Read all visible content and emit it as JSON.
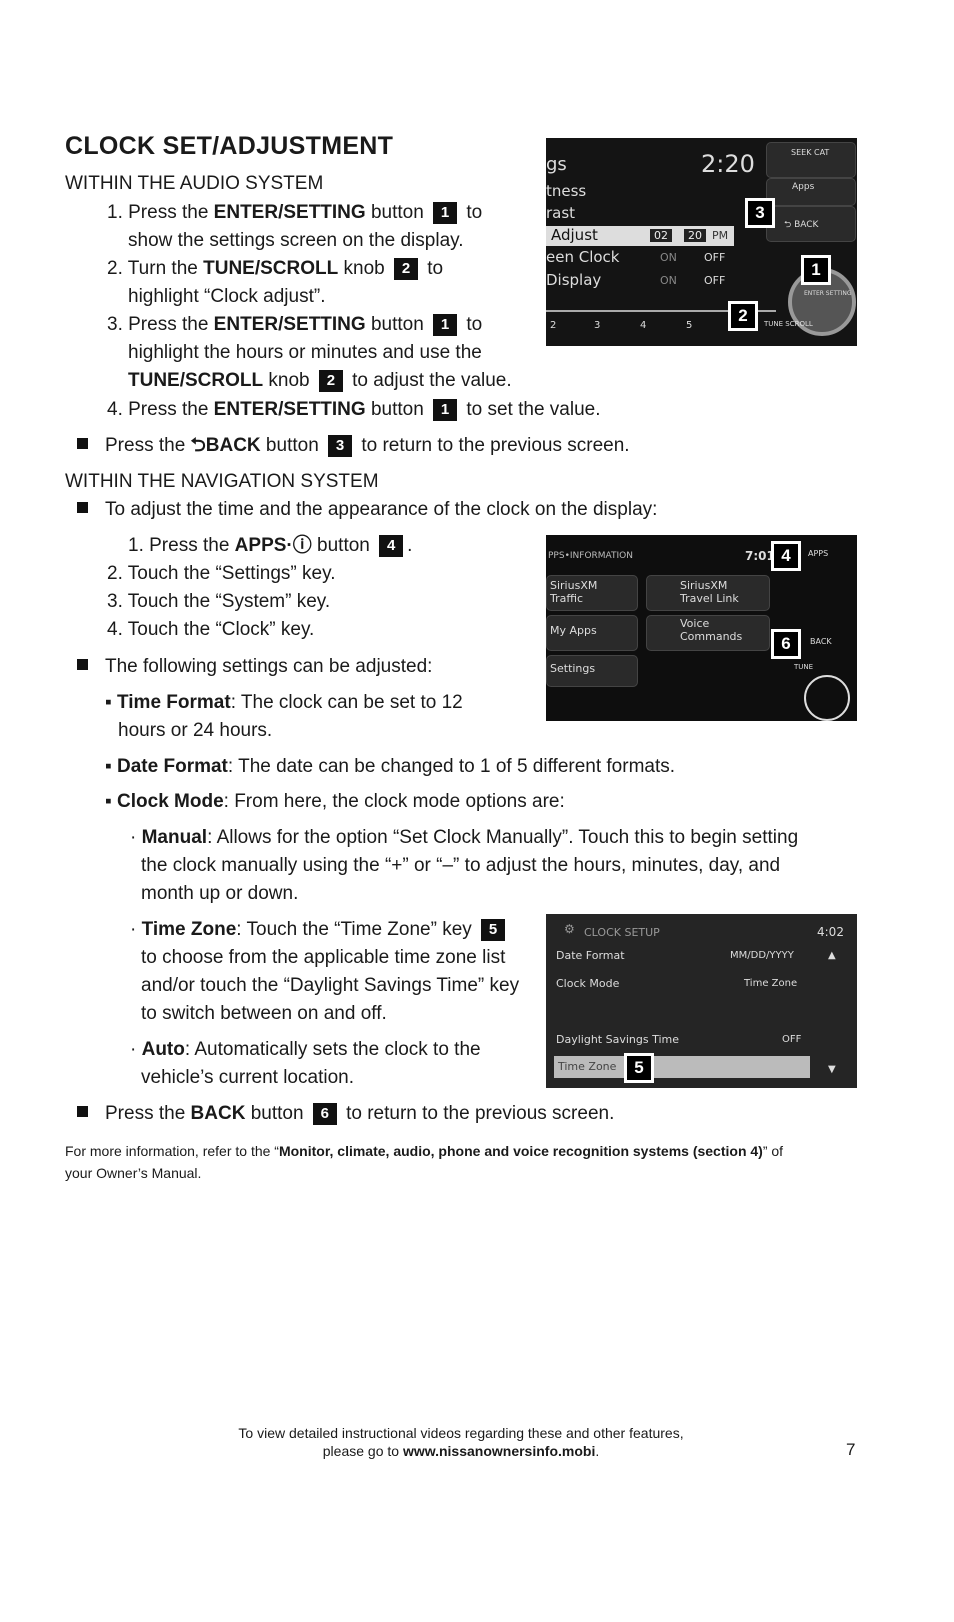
{
  "heading": "CLOCK SET/ADJUSTMENT",
  "lines": [
    [
      {
        "t": "WITHIN THE AUDIO SYSTEM"
      }
    ],
    [
      {
        "t": "1. Press the "
      },
      {
        "b": "ENTER/SETTING"
      },
      {
        "t": " button "
      },
      {
        "badge": "1"
      },
      {
        "t": " to"
      }
    ],
    [
      {
        "t": "show the settings screen on the display."
      }
    ],
    [
      {
        "t": "2. Turn the "
      },
      {
        "b": "TUNE/SCROLL"
      },
      {
        "t": " knob "
      },
      {
        "badge": "2"
      },
      {
        "t": " to"
      }
    ],
    [
      {
        "t": "highlight “Clock adjust”."
      }
    ],
    [
      {
        "t": "3. Press the "
      },
      {
        "b": "ENTER/SETTING"
      },
      {
        "t": " button "
      },
      {
        "badge": "1"
      },
      {
        "t": " to"
      }
    ],
    [
      {
        "t": "highlight the hours or minutes and use the"
      }
    ],
    [
      {
        "b": "TUNE/SCROLL"
      },
      {
        "t": " knob "
      },
      {
        "badge": "2"
      },
      {
        "t": " to adjust the value."
      }
    ],
    [
      {
        "t": "4. Press the "
      },
      {
        "b": "ENTER/SETTING"
      },
      {
        "t": " button "
      },
      {
        "badge": "1"
      },
      {
        "t": " to set the value."
      }
    ],
    [
      {
        "sq": true
      },
      {
        "t": "Press the "
      },
      {
        "b": "⮌BACK"
      },
      {
        "t": " button "
      },
      {
        "badge": "3"
      },
      {
        "t": " to return to the previous screen."
      }
    ],
    [
      {
        "t": "WITHIN THE NAVIGATION SYSTEM"
      }
    ],
    [
      {
        "sq": true
      },
      {
        "t": "To adjust the time and the appearance of the clock on the display:"
      }
    ],
    [
      {
        "t": "1. Press the "
      },
      {
        "b": "APPS·ⓘ"
      },
      {
        "t": " button "
      },
      {
        "badge": "4"
      },
      {
        "t": "."
      }
    ],
    [
      {
        "t": "2. Touch the “Settings” key."
      }
    ],
    [
      {
        "t": "3. Touch the “System” key."
      }
    ],
    [
      {
        "t": "4. Touch the “Clock” key."
      }
    ],
    [
      {
        "sq": true
      },
      {
        "t": "The following settings can be adjusted:"
      }
    ],
    [
      {
        "t": "▪ "
      },
      {
        "b": "Time Format"
      },
      {
        "t": ": The clock can be set to 12"
      }
    ],
    [
      {
        "t": "hours or 24 hours."
      }
    ],
    [
      {
        "t": "▪ "
      },
      {
        "b": "Date Format"
      },
      {
        "t": ": The date can be changed to 1 of 5 different formats."
      }
    ],
    [
      {
        "t": "▪ "
      },
      {
        "b": "Clock Mode"
      },
      {
        "t": ": From here, the clock mode options are:"
      }
    ],
    [
      {
        "t": "· "
      },
      {
        "b": "Manual"
      },
      {
        "t": ": Allows for the option “Set Clock Manually”. Touch this to begin setting"
      }
    ],
    [
      {
        "t": "the clock manually using the “+” or “–” to adjust the hours, minutes, day, and"
      }
    ],
    [
      {
        "t": "month up or down."
      }
    ],
    [
      {
        "t": "· "
      },
      {
        "b": "Time Zone"
      },
      {
        "t": ": Touch the “Time Zone” key "
      },
      {
        "badge": "5"
      }
    ],
    [
      {
        "t": "to choose from the applicable time zone list"
      }
    ],
    [
      {
        "t": "and/or touch the “Daylight Savings Time” key"
      }
    ],
    [
      {
        "t": "to switch between on and off."
      }
    ],
    [
      {
        "t": "· "
      },
      {
        "b": "Auto"
      },
      {
        "t": ": Automatically sets the clock to the"
      }
    ],
    [
      {
        "t": "vehicle’s current location."
      }
    ],
    [
      {
        "sq": true
      },
      {
        "t": "Press the "
      },
      {
        "b": "BACK"
      },
      {
        "t": " button "
      },
      {
        "badge": "6"
      },
      {
        "t": " to return to the previous screen."
      }
    ]
  ],
  "footnote": {
    "pre": "For more information, refer to the “",
    "bold": "Monitor, climate, audio, phone and voice recognition systems (section 4)",
    "post": "” of",
    "line2": "your Owner’s Manual."
  },
  "footer": {
    "line1": "To view detailed instructional videos regarding these and other features,",
    "pre": "please go to ",
    "url": "www.nissanownersinfo.mobi",
    "post": ".",
    "page": "7"
  },
  "shot1": {
    "time": "2:20",
    "rows": [
      "gs",
      "tness",
      "rast",
      "Adjust",
      "een Clock",
      "Display"
    ],
    "hour": "02",
    "minute": "20",
    "ampm": "PM",
    "on": "ON",
    "off": "OFF",
    "buttons": [
      "SEEK CAT",
      "Apps",
      "⮌ BACK"
    ],
    "knob": "ENTER SETTING",
    "knob2": "TUNE SCROLL",
    "presets": [
      "2",
      "3",
      "4",
      "5"
    ],
    "callouts": [
      "3",
      "1",
      "2"
    ]
  },
  "shot2": {
    "title": "PPS•INFORMATION",
    "time": "7:01",
    "tiles": [
      "SiriusXM Traffic",
      "SiriusXM Travel Link",
      "My Apps",
      "Voice Commands",
      "Settings"
    ],
    "side": [
      "APPS",
      "BACK",
      "TUNE"
    ],
    "callouts": [
      "4",
      "6"
    ]
  },
  "shot3": {
    "title": "CLOCK SETUP",
    "time": "4:02",
    "rows": [
      {
        "label": "Date Format",
        "value": "MM/DD/YYYY"
      },
      {
        "label": "Clock Mode",
        "value": "Time Zone"
      },
      {
        "label": "Daylight Savings Time",
        "value": "OFF"
      },
      {
        "label": "Time Zone",
        "value": ""
      }
    ],
    "callout": "5"
  }
}
